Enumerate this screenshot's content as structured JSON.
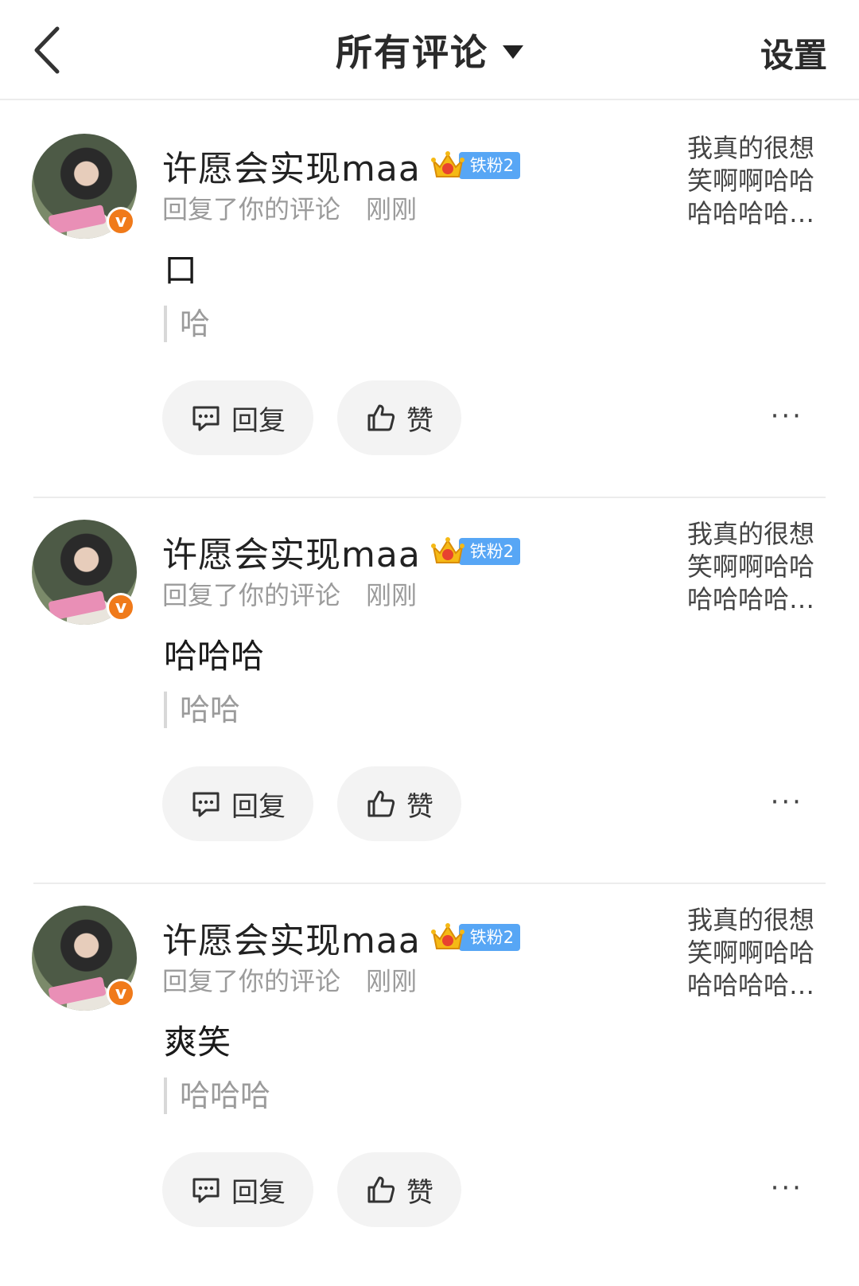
{
  "header": {
    "title": "所有评论",
    "settings_label": "设置"
  },
  "comments": [
    {
      "username": "许愿会实现maa",
      "fan_badge": "铁粉2",
      "action": "回复了你的评论",
      "time": "刚刚",
      "preview": "我真的很想笑啊啊哈哈哈哈哈哈…",
      "preview_lines": [
        "我真的很想",
        "笑啊啊哈哈",
        "哈哈哈哈…"
      ],
      "text": "口",
      "quote": "哈",
      "reply_label": "回复",
      "like_label": "赞",
      "more_label": "···"
    },
    {
      "username": "许愿会实现maa",
      "fan_badge": "铁粉2",
      "action": "回复了你的评论",
      "time": "刚刚",
      "preview_lines": [
        "我真的很想",
        "笑啊啊哈哈",
        "哈哈哈哈…"
      ],
      "text": "哈哈哈",
      "quote": "哈哈",
      "reply_label": "回复",
      "like_label": "赞",
      "more_label": "···"
    },
    {
      "username": "许愿会实现maa",
      "fan_badge": "铁粉2",
      "action": "回复了你的评论",
      "time": "刚刚",
      "preview_lines": [
        "我真的很想",
        "笑啊啊哈哈",
        "哈哈哈哈…"
      ],
      "text": "爽笑",
      "quote": "哈哈哈",
      "reply_label": "回复",
      "like_label": "赞",
      "more_label": "···"
    }
  ],
  "icons": {
    "back": "chevron-left-icon",
    "dropdown": "caret-down-icon",
    "reply": "comment-bubble-icon",
    "like": "thumbs-up-icon",
    "verified": "verified-v-icon",
    "crown": "crown-icon"
  },
  "colors": {
    "verified_badge": "#f07a1a",
    "fan_badge": "#57a6f5",
    "pill_bg": "#f3f3f3",
    "secondary_text": "#9b9b9b"
  }
}
